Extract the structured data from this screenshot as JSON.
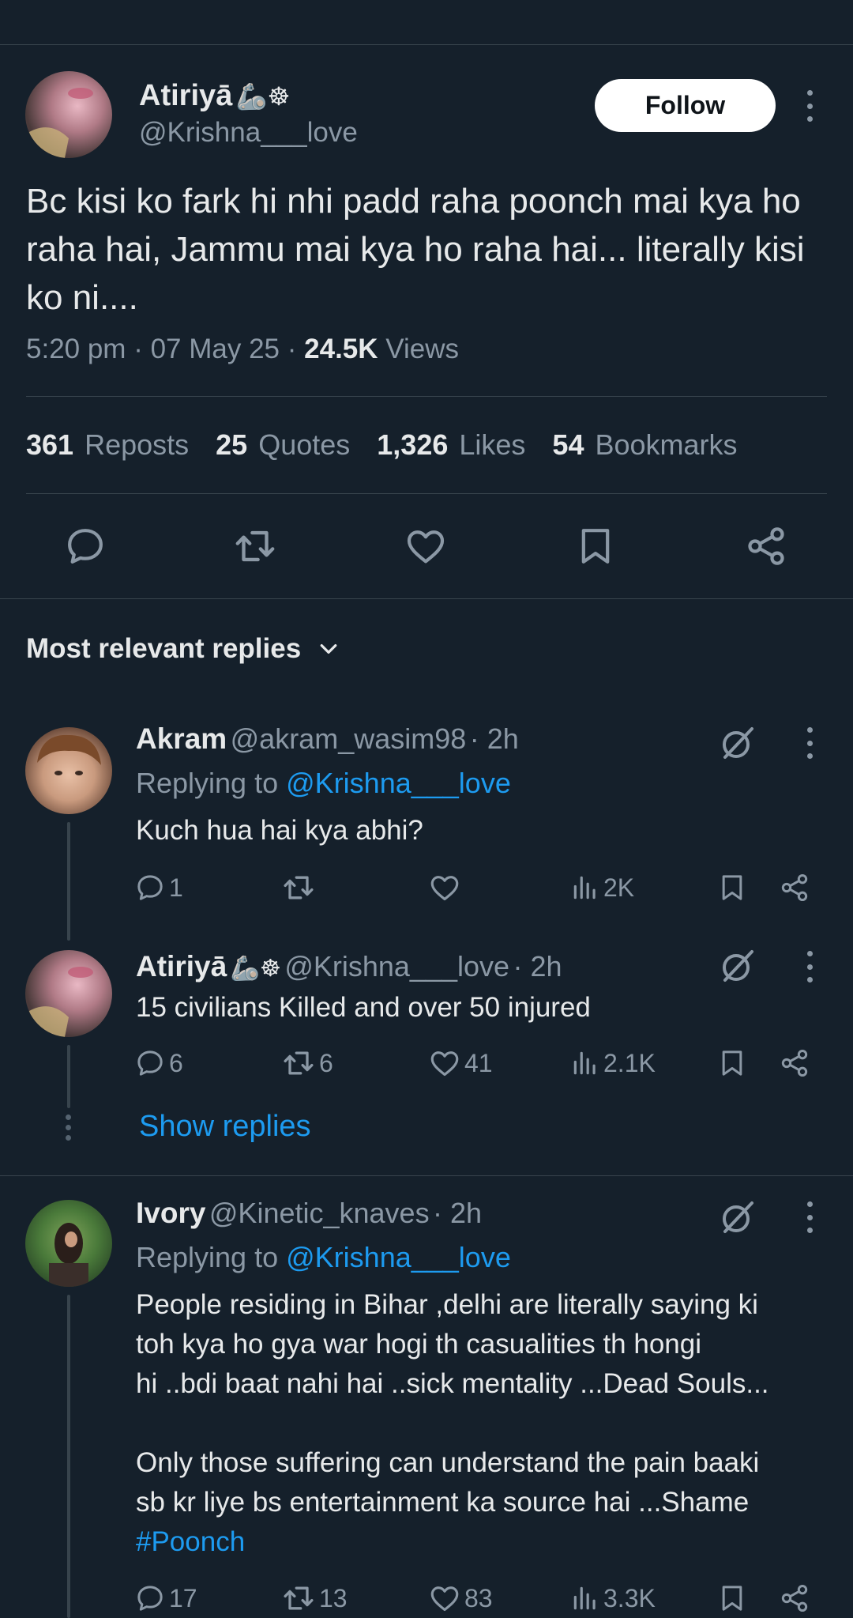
{
  "main_tweet": {
    "author_name": "Atiriyā",
    "author_emoji": "🦾☸",
    "author_handle": "@Krishna___love",
    "follow_label": "Follow",
    "text": "Bc kisi ko fark hi nhi padd raha poonch mai kya ho raha hai, Jammu mai kya ho raha hai... literally kisi ko ni....",
    "time": "5:20 pm",
    "date": "07 May 25",
    "views_count": "24.5K",
    "views_label": "Views",
    "stats": [
      {
        "count": "361",
        "label": "Reposts"
      },
      {
        "count": "25",
        "label": "Quotes"
      },
      {
        "count": "1,326",
        "label": "Likes"
      },
      {
        "count": "54",
        "label": "Bookmarks"
      }
    ]
  },
  "replies_header": {
    "label": "Most relevant replies"
  },
  "replies": [
    {
      "name": "Akram",
      "handle": "@akram_wasim98",
      "time": "· 2h",
      "replying_prefix": "Replying to",
      "replying_to": "@Krishna___love",
      "text": "Kuch hua hai kya abhi?",
      "replies": "1",
      "reposts": "",
      "likes": "",
      "views": "2K"
    },
    {
      "name": "Atiriyā",
      "name_emoji": "🦾☸",
      "handle": "@Krishna___love",
      "time": "· 2h",
      "text": "15 civilians Killed and over 50 injured",
      "replies": "6",
      "reposts": "6",
      "likes": "41",
      "views": "2.1K",
      "show_replies": "Show replies"
    },
    {
      "name": "Ivory",
      "handle": "@Kinetic_knaves",
      "time": "· 2h",
      "replying_prefix": "Replying to",
      "replying_to": "@Krishna___love",
      "text_lines": [
        "People residing in Bihar ,delhi are literally saying ki",
        "toh kya ho gya war hogi th casualities th hongi",
        "hi ..bdi baat nahi hai ..sick mentality ...Dead Souls...",
        "",
        "Only those suffering can understand the pain baaki",
        "sb kr liye bs entertainment ka source hai ...Shame"
      ],
      "hashtag": "#Poonch",
      "replies": "17",
      "reposts": "13",
      "likes": "83",
      "views": "3.3K"
    }
  ],
  "colors": {
    "background": "#15202b",
    "text": "#e7e9ea",
    "muted": "#8b98a5",
    "accent": "#1d9bf0",
    "divider": "#38444d"
  }
}
